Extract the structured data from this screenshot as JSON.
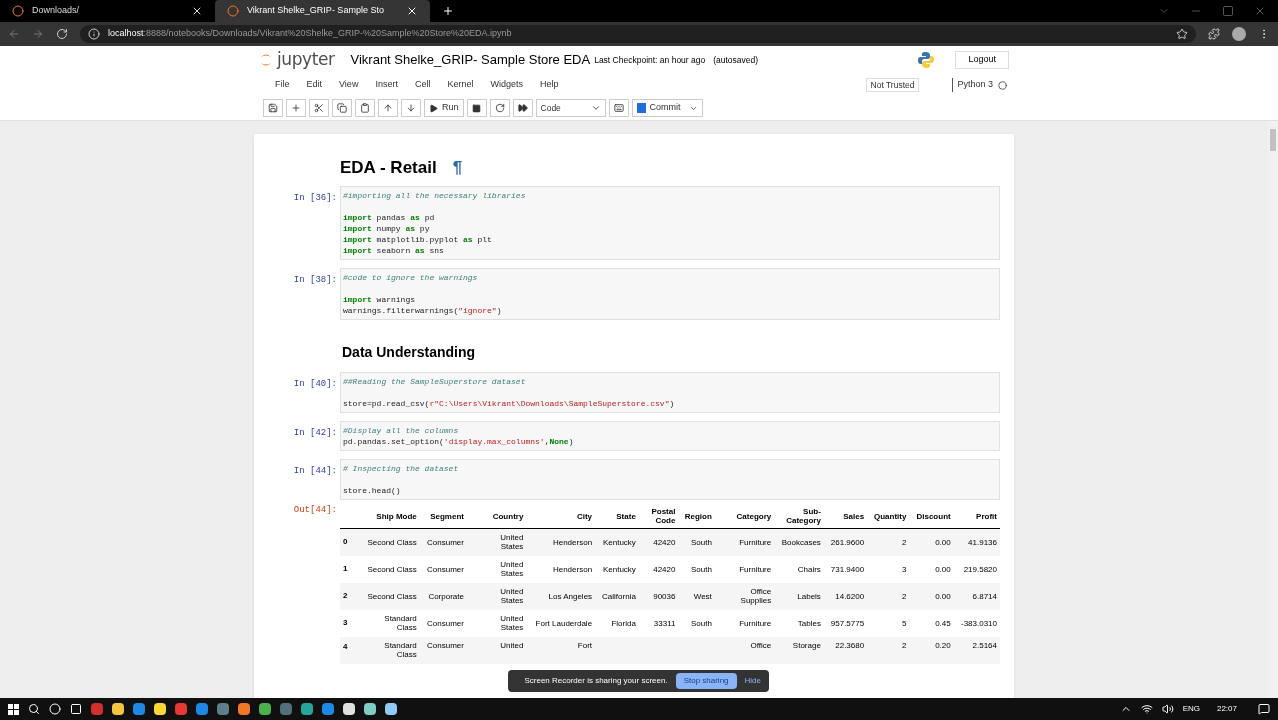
{
  "browser": {
    "tabs": [
      {
        "title": "Downloads/",
        "selected": false
      },
      {
        "title": "Vikrant Shelke_GRIP- Sample Sto",
        "selected": true
      }
    ],
    "url_host": "localhost",
    "url_path": ":8888/notebooks/Downloads/Vikrant%20Shelke_GRIP-%20Sample%20Store%20EDA.ipynb"
  },
  "header": {
    "logo": "jupyter",
    "title": "Vikrant Shelke_GRIP- Sample Store EDA",
    "checkpoint": "Last Checkpoint: an hour ago",
    "autosaved": "(autosaved)",
    "logout": "Logout"
  },
  "menu": [
    "File",
    "Edit",
    "View",
    "Insert",
    "Cell",
    "Kernel",
    "Widgets",
    "Help"
  ],
  "trust": "Not Trusted",
  "kernel": "Python 3",
  "toolbar": {
    "run": "Run",
    "cell_type": "Code",
    "commit": "Commit"
  },
  "cells": [
    {
      "kind": "title",
      "text": "EDA - Retail",
      "anchor": "¶"
    },
    {
      "kind": "code",
      "prompt": "In [36]:",
      "blocks": [
        [
          [
            {
              "kind": "comment",
              "text": "#importing all the necessary libraries"
            }
          ]
        ],
        [
          [
            {
              "kind": "keyword",
              "text": "import"
            },
            {
              "kind": "plain",
              "text": " pandas "
            },
            {
              "kind": "keyword",
              "text": "as"
            },
            {
              "kind": "plain",
              "text": " pd"
            }
          ],
          [
            {
              "kind": "keyword",
              "text": "import"
            },
            {
              "kind": "plain",
              "text": " numpy "
            },
            {
              "kind": "keyword",
              "text": "as"
            },
            {
              "kind": "plain",
              "text": " py"
            }
          ],
          [
            {
              "kind": "keyword",
              "text": "import"
            },
            {
              "kind": "plain",
              "text": " matplotlib.pyplot "
            },
            {
              "kind": "keyword",
              "text": "as"
            },
            {
              "kind": "plain",
              "text": " plt"
            }
          ],
          [
            {
              "kind": "keyword",
              "text": "import"
            },
            {
              "kind": "plain",
              "text": " seaborn "
            },
            {
              "kind": "keyword",
              "text": "as"
            },
            {
              "kind": "plain",
              "text": " sns"
            }
          ]
        ]
      ]
    },
    {
      "kind": "code",
      "prompt": "In [38]:",
      "blocks": [
        [
          [
            {
              "kind": "comment",
              "text": "#code to ignore the warnings"
            }
          ]
        ],
        [
          [
            {
              "kind": "keyword",
              "text": "import"
            },
            {
              "kind": "plain",
              "text": " warnings"
            }
          ],
          [
            {
              "kind": "plain",
              "text": "warnings.filterwarnings("
            },
            {
              "kind": "string",
              "text": "\"ignore\""
            },
            {
              "kind": "plain",
              "text": ")"
            }
          ]
        ]
      ]
    },
    {
      "kind": "section",
      "text": "Data Understanding"
    },
    {
      "kind": "code",
      "prompt": "In [40]:",
      "blocks": [
        [
          [
            {
              "kind": "comment",
              "text": "##Reading the SampleSuperstore dataset"
            }
          ]
        ],
        [
          [
            {
              "kind": "plain",
              "text": "store=pd.read_csv("
            },
            {
              "kind": "string",
              "text": "r\"C:\\Users\\Vikrant\\Downloads\\SampleSuperstore.csv\""
            },
            {
              "kind": "plain",
              "text": ")"
            }
          ]
        ]
      ]
    },
    {
      "kind": "code",
      "prompt": "In [42]:",
      "blocks": [
        [
          [
            {
              "kind": "comment",
              "text": "#Display all the columns"
            }
          ],
          [
            {
              "kind": "plain",
              "text": "pd.pandas.set_option("
            },
            {
              "kind": "string",
              "text": "'display.max_columns'"
            },
            {
              "kind": "plain",
              "text": ","
            },
            {
              "kind": "keyword",
              "text": "None"
            },
            {
              "kind": "plain",
              "text": ")"
            }
          ]
        ]
      ]
    },
    {
      "kind": "code",
      "prompt": "In [44]:",
      "blocks": [
        [
          [
            {
              "kind": "comment",
              "text": "# Inspecting the dataset"
            }
          ]
        ],
        [
          [
            {
              "kind": "plain",
              "text": "store.head()"
            }
          ]
        ]
      ]
    },
    {
      "kind": "table",
      "prompt": "Out[44]:",
      "columns": [
        "Ship Mode",
        "Segment",
        "Country",
        "City",
        "State",
        "Postal Code",
        "Region",
        "Category",
        "Sub-Category",
        "Sales",
        "Quantity",
        "Discount",
        "Profit"
      ],
      "rows": [
        {
          "index": "0",
          "cells": [
            "Second Class",
            "Consumer",
            "United States",
            "Henderson",
            "Kentucky",
            "42420",
            "South",
            "Furniture",
            "Bookcases",
            "261.9600",
            "2",
            "0.00",
            "41.9136"
          ]
        },
        {
          "index": "1",
          "cells": [
            "Second Class",
            "Consumer",
            "United States",
            "Henderson",
            "Kentucky",
            "42420",
            "South",
            "Furniture",
            "Chairs",
            "731.9400",
            "3",
            "0.00",
            "219.5820"
          ]
        },
        {
          "index": "2",
          "cells": [
            "Second Class",
            "Corporate",
            "United States",
            "Los Angeles",
            "California",
            "90036",
            "West",
            "Office Supplies",
            "Labels",
            "14.6200",
            "2",
            "0.00",
            "6.8714"
          ]
        },
        {
          "index": "3",
          "cells": [
            "Standard Class",
            "Consumer",
            "United States",
            "Fort Lauderdale",
            "Florida",
            "33311",
            "South",
            "Furniture",
            "Tables",
            "957.5775",
            "5",
            "0.45",
            "-383.0310"
          ]
        },
        {
          "index": "4",
          "cells": [
            "Standard Class",
            "Consumer",
            "United",
            "Fort",
            null,
            null,
            null,
            "Office",
            "Storage",
            "22.3680",
            "2",
            "0.20",
            "2.5164"
          ]
        }
      ]
    }
  ],
  "share_bar": {
    "message": "Screen Recorder is sharing your screen.",
    "stop": "Stop sharing",
    "hide": "Hide"
  },
  "taskbar": {
    "language": "ENG",
    "time": "22:07"
  }
}
